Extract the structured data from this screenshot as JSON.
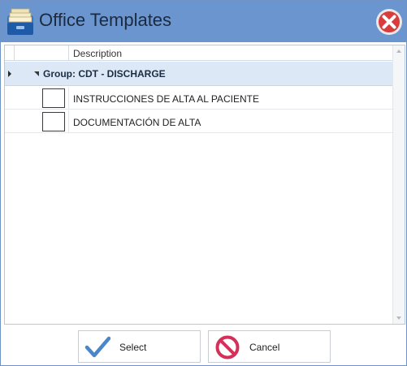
{
  "window": {
    "title": "Office Templates",
    "app_icon": "document-stack-icon",
    "close_icon": "close-icon",
    "accent_color": "#6b95cf"
  },
  "grid": {
    "columns": [
      "",
      "",
      "Description"
    ],
    "group": {
      "label": "Group: CDT - DISCHARGE",
      "expanded": true,
      "row_color": "#dce8f6"
    },
    "rows": [
      {
        "checked": false,
        "description": "INSTRUCCIONES DE ALTA AL PACIENTE"
      },
      {
        "checked": false,
        "description": "DOCUMENTACIÓN DE ALTA"
      }
    ]
  },
  "buttons": {
    "select_label": "Select",
    "select_icon": "checkmark-icon",
    "cancel_label": "Cancel",
    "cancel_icon": "no-entry-icon"
  }
}
